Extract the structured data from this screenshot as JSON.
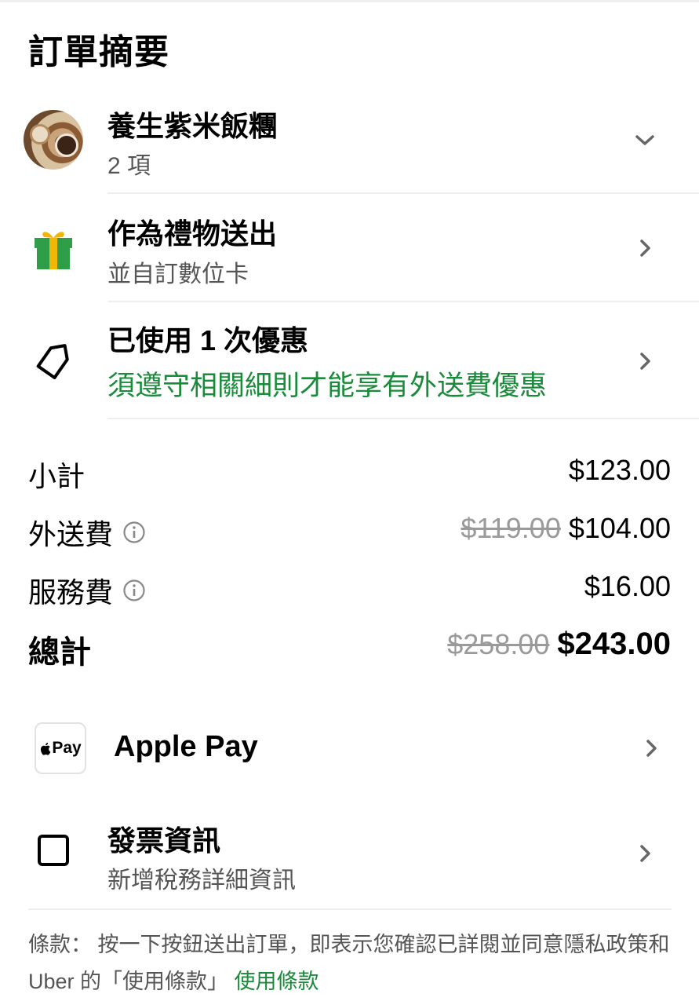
{
  "page": {
    "title": "訂單摘要"
  },
  "store": {
    "name": "養生紫米飯糰",
    "items": "2 項"
  },
  "gift": {
    "title": "作為禮物送出",
    "subtitle": "並自訂數位卡"
  },
  "promo": {
    "title": "已使用 1 次優惠",
    "subtitle": "須遵守相關細則才能享有外送費優惠"
  },
  "summary": {
    "subtotal": {
      "label": "小計",
      "value": "$123.00"
    },
    "delivery": {
      "label": "外送費",
      "original": "$119.00",
      "value": "$104.00"
    },
    "service": {
      "label": "服務費",
      "value": "$16.00"
    },
    "total": {
      "label": "總計",
      "original": "$258.00",
      "value": "$243.00"
    }
  },
  "payment": {
    "icon_text": "Pay",
    "label": "Apple Pay"
  },
  "invoice": {
    "title": "發票資訊",
    "subtitle": "新增稅務詳細資訊"
  },
  "terms": {
    "text": "條款： 按一下按鈕送出訂單，即表示您確認已詳閱並同意隱私政策和 Uber 的「使用條款」",
    "link": "使用條款"
  },
  "colors": {
    "accent_green": "#1a8b3a",
    "gift_green": "#2e9e48",
    "gift_ribbon": "#f2b705"
  }
}
